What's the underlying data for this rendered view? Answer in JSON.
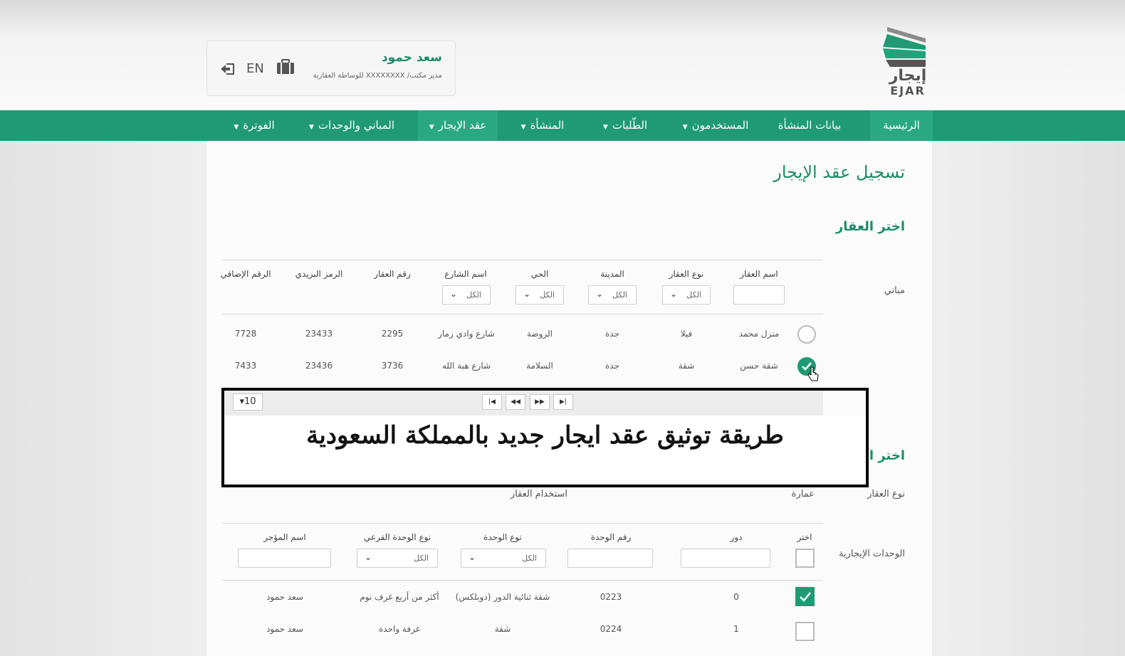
{
  "header": {
    "user_name": "سعد حمود",
    "user_role": "مدير مكتب/ XXXXXXXX للوساطة العقارية",
    "lang_label": "EN",
    "logo_ar": "إيجار",
    "logo_en": "EJAR"
  },
  "nav": {
    "items": [
      {
        "label": "الرئيسية",
        "dropdown": false,
        "active": true
      },
      {
        "label": "بيانات المنشأة",
        "dropdown": false,
        "active": false
      },
      {
        "label": "المستخدمون",
        "dropdown": true,
        "active": false
      },
      {
        "label": "الطّلبات",
        "dropdown": true,
        "active": false
      },
      {
        "label": "المنشأة",
        "dropdown": true,
        "active": false
      },
      {
        "label": "عقد الإيجار",
        "dropdown": true,
        "active": true
      },
      {
        "label": "المباني والوحدات",
        "dropdown": true,
        "active": false
      },
      {
        "label": "الفوترة",
        "dropdown": true,
        "active": false
      }
    ]
  },
  "page": {
    "title": "تسجيل عقد الإيجار",
    "property_section": "اختر العقار",
    "buildings_label": "مباني",
    "units_section": "اختر الوحدات",
    "property_type_label": "نوع العقار",
    "property_type_value": "عمارة",
    "property_usage_label": "استخدام العقار",
    "rental_units_label": "الوحدات الإيجارية"
  },
  "property_table": {
    "columns": [
      "اسم العقار",
      "نوع العقار",
      "المدينة",
      "الحي",
      "اسم الشارع",
      "رقم العقار",
      "الرمز البريدي",
      "الرقم الإضافي"
    ],
    "filter_all": "الكل",
    "rows": [
      {
        "selected": false,
        "cells": [
          "منزل محمد",
          "فيلا",
          "جدة",
          "الروضة",
          "شارع وادي زمار",
          "2295",
          "23433",
          "7728"
        ]
      },
      {
        "selected": true,
        "cells": [
          "شقة حسن",
          "شقة",
          "جدة",
          "السلامة",
          "شارع هبة الله",
          "3736",
          "23436",
          "7433"
        ]
      }
    ],
    "page_size": "10"
  },
  "units_table": {
    "columns": [
      "اختر",
      "دور",
      "رقم الوحدة",
      "نوع الوحدة",
      "نوع الوحدة الفرعي",
      "اسم المؤجر"
    ],
    "filter_all": "الكل",
    "rows": [
      {
        "selected": true,
        "cells": [
          "0",
          "0223",
          "شقة ثنائية الدور (دوبلكس)",
          "أكثر من أربع غرف نوم",
          "سعد حمود"
        ]
      },
      {
        "selected": false,
        "cells": [
          "1",
          "0224",
          "شقة",
          "غرفة واحدة",
          "سعد حمود"
        ]
      }
    ]
  },
  "overlay": {
    "caption": "طريقة توثيق عقد ايجار جديد بالمملكة السعودية"
  },
  "colors": {
    "brand_green": "#1f9a72",
    "title_green": "#1e8c6a"
  }
}
